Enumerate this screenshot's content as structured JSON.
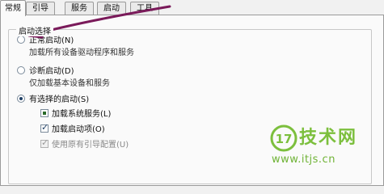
{
  "tabs": [
    {
      "label": "常规",
      "active": true
    },
    {
      "label": "引导",
      "active": false
    },
    {
      "label": "服务",
      "active": false
    },
    {
      "label": "启动",
      "active": false
    },
    {
      "label": "工具",
      "active": false
    }
  ],
  "startup_group": {
    "title": "启动选择",
    "normal": {
      "label": "正常启动(N)",
      "description": "加载所有设备驱动程序和服务",
      "selected": false
    },
    "diagnostic": {
      "label": "诊断启动(D)",
      "description": "仅加载基本设备和服务",
      "selected": false
    },
    "selective": {
      "label": "有选择的启动(S)",
      "selected": true
    }
  },
  "options": {
    "load_system_services": {
      "label": "加载系统服务(L)",
      "state": "partial"
    },
    "load_startup_items": {
      "label": "加载启动项(O)",
      "state": "checked"
    },
    "use_original_boot": {
      "label": "使用原有引导配置(U)",
      "state": "checked-disabled"
    }
  },
  "watermark": {
    "logo_glyph": "17",
    "brand": "技术网",
    "url": "www.itjs.cn"
  },
  "annotation": {
    "color": "#7a1a5a",
    "shape": "arrow"
  }
}
